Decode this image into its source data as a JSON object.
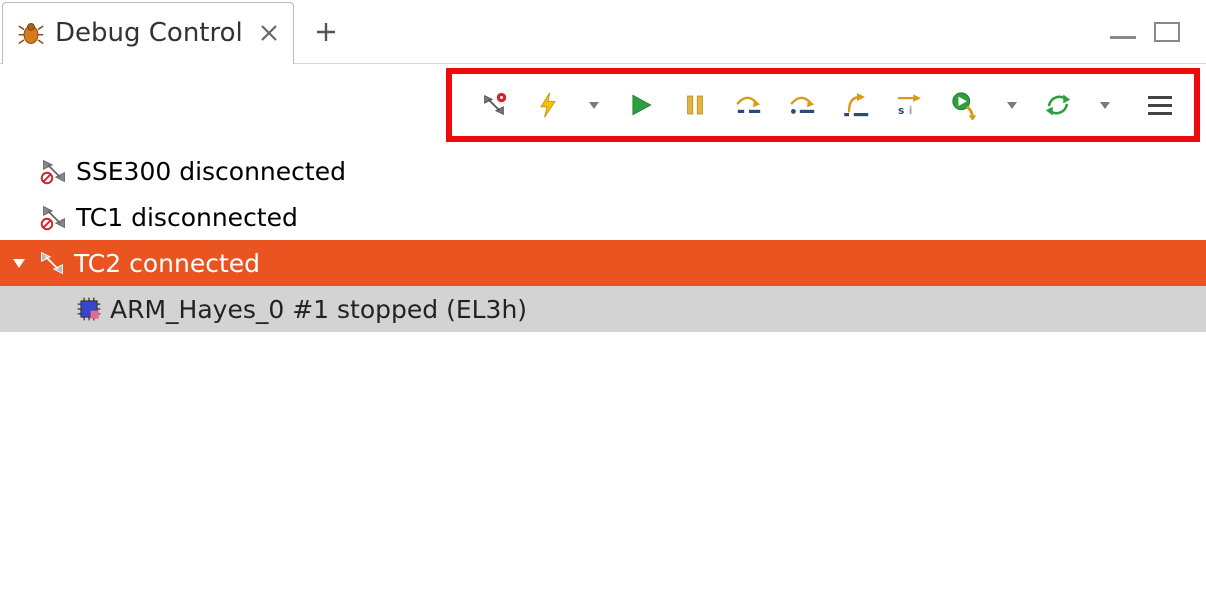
{
  "tabs": {
    "active": {
      "label": "Debug Control"
    }
  },
  "toolbar": {
    "icons": {
      "connect": "connect-target-icon",
      "debug_from": "debug-lightning-icon",
      "resume": "resume-icon",
      "pause": "pause-icon",
      "step_over_source": "step-over-source-icon",
      "step_over_instr": "step-over-instruction-icon",
      "step_out": "step-out-icon",
      "step_into": "step-into-instruction-icon",
      "run_to": "run-to-icon",
      "refresh": "refresh-icon",
      "menu": "hamburger-icon"
    }
  },
  "targets": [
    {
      "label": "SSE300 disconnected",
      "state": "disconnected"
    },
    {
      "label": "TC1 disconnected",
      "state": "disconnected"
    },
    {
      "label": "TC2 connected",
      "state": "connected",
      "selected": true,
      "children": [
        {
          "label": "ARM_Hayes_0 #1 stopped (EL3h)"
        }
      ]
    }
  ]
}
